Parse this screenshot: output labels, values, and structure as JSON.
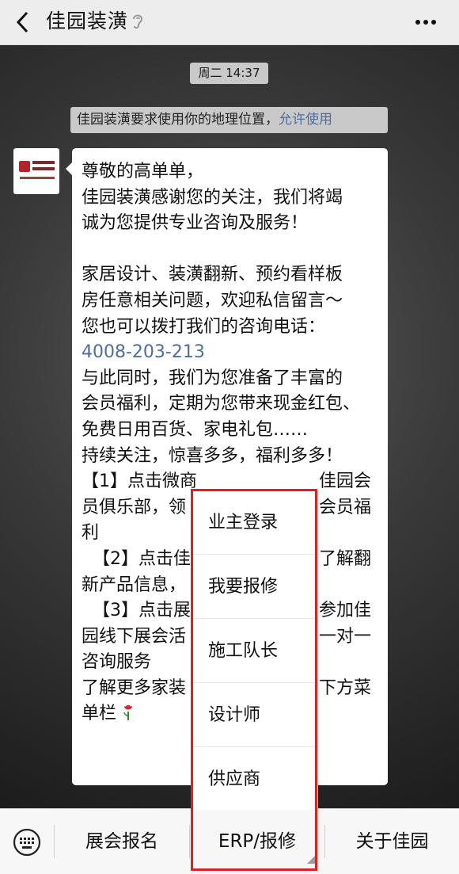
{
  "header": {
    "title": "佳园装潢"
  },
  "chat": {
    "timestamp": "周二 14:37",
    "system_note": "佳园装潢要求使用你的地理位置，",
    "system_note_action": "允许使用",
    "message_lines": [
      "尊敬的高单单，",
      " 佳园装潢感谢您的关注，我们将竭",
      "诚为您提供专业咨询及服务！",
      "",
      "家居设计、装潢翻新、预约看样板",
      "房任意相关问题，欢迎私信留言～",
      "您也可以拨打我们的咨询电话：",
      "与此同时，我们为您准备了丰富的",
      "会员福利，定期为您带来现金红包、",
      "免费日用百货、家电礼包……",
      "持续关注，惊喜多多，福利多多！",
      "【1】点击微商",
      "员俱乐部，领",
      "利",
      "  【2】点击佳",
      "新产品信息，",
      "  【3】点击展",
      "园线下展会活",
      "咨询服务",
      "了解更多家装",
      "单栏"
    ],
    "phone": "4008-203-213",
    "message_right_fragments": [
      "佳园会",
      "会员福",
      "了解翻",
      "参加佳",
      "一对一",
      "下方菜"
    ]
  },
  "popup_menu": {
    "items": [
      "业主登录",
      "我要报修",
      "施工队长",
      "设计师",
      "供应商"
    ]
  },
  "bottom_menu": {
    "items": [
      "展会报名",
      "ERP/报修",
      "关于佳园"
    ]
  },
  "colors": {
    "link": "#4f6e9b",
    "highlight_border": "#e0201e",
    "bubble": "#ffffff"
  },
  "icons": {
    "back": "back-icon",
    "ear": "ear-icon",
    "more": "more-icon",
    "keyboard": "keyboard-icon",
    "flower": "flower-icon"
  }
}
